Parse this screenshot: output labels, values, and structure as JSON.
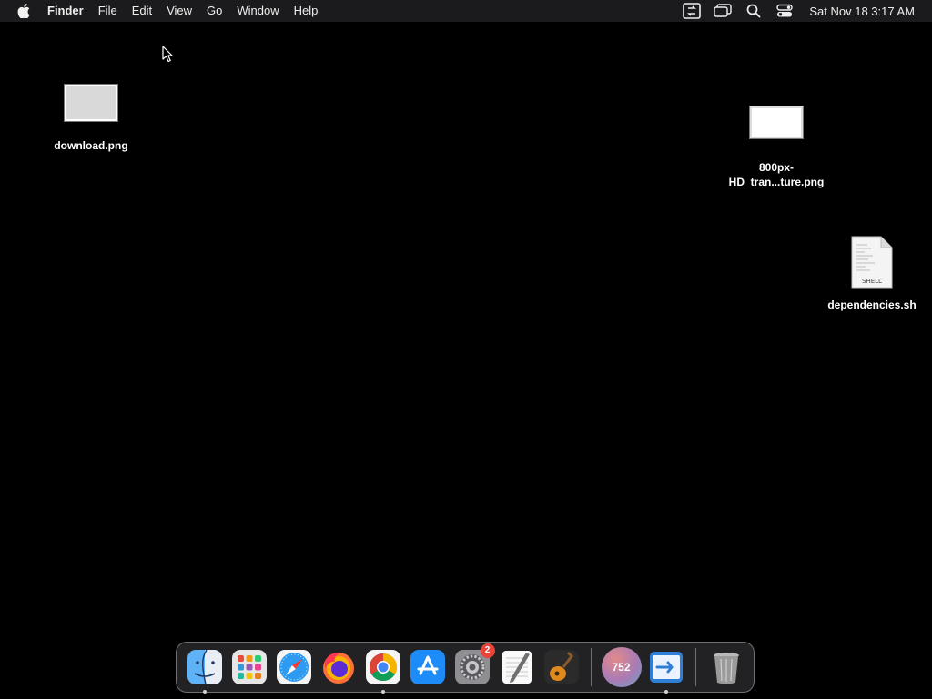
{
  "menubar": {
    "app_name": "Finder",
    "menus": [
      "File",
      "Edit",
      "View",
      "Go",
      "Window",
      "Help"
    ],
    "clock": "Sat Nov 18  3:17 AM"
  },
  "desktop": {
    "icons": [
      {
        "name": "download.png"
      },
      {
        "name_line1": "800px-",
        "name_line2": "HD_tran...ture.png"
      },
      {
        "name": "dependencies.sh",
        "badge_text": "SHELL"
      }
    ]
  },
  "dock": {
    "system_settings_badge": "2",
    "counter_value": "752",
    "apps": [
      "Finder",
      "Launchpad",
      "Safari",
      "Firefox",
      "Google Chrome",
      "App Store",
      "System Settings",
      "TextEdit",
      "GarageBand",
      "Counter",
      "Migration",
      "Trash"
    ]
  }
}
